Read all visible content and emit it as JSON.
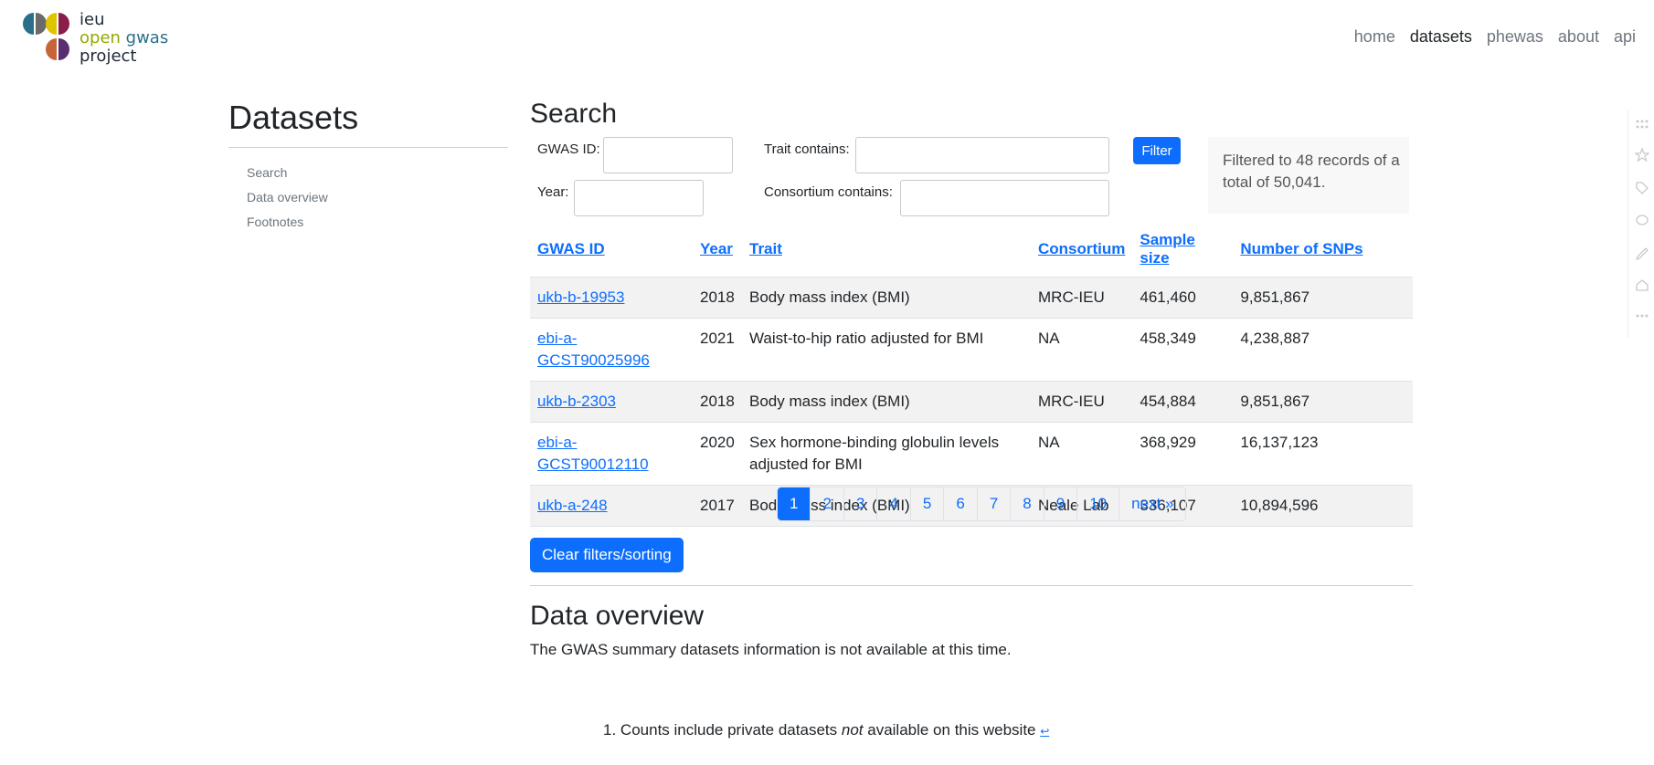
{
  "brand": {
    "line1": "ieu",
    "line2_a": "open",
    "line2_b": "gwas",
    "line3": "project"
  },
  "nav": [
    {
      "label": "home"
    },
    {
      "label": "datasets",
      "active": true
    },
    {
      "label": "phewas"
    },
    {
      "label": "about"
    },
    {
      "label": "api"
    }
  ],
  "sidebar": {
    "title": "Datasets",
    "items": [
      "Search",
      "Data overview",
      "Footnotes"
    ]
  },
  "search": {
    "title": "Search",
    "gwas_id_label": "GWAS ID:",
    "year_label": "Year:",
    "trait_label": "Trait contains:",
    "consortium_label": "Consortium contains:",
    "filter_button": "Filter",
    "records_text": "Filtered to 48 records of a total of 50,041."
  },
  "table": {
    "headers": [
      "GWAS ID",
      "Year",
      "Trait",
      "Consortium",
      "Sample size",
      "Number of SNPs"
    ],
    "rows": [
      [
        "ukb-b-19953",
        "2018",
        "Body mass index (BMI)",
        "MRC-IEU",
        "461,460",
        "9,851,867"
      ],
      [
        "ebi-a-GCST90025996",
        "2021",
        "Waist-to-hip ratio adjusted for BMI",
        "NA",
        "458,349",
        "4,238,887"
      ],
      [
        "ukb-b-2303",
        "2018",
        "Body mass index (BMI)",
        "MRC-IEU",
        "454,884",
        "9,851,867"
      ],
      [
        "ebi-a-GCST90012110",
        "2020",
        "Sex hormone-binding globulin levels adjusted for BMI",
        "NA",
        "368,929",
        "16,137,123"
      ],
      [
        "ukb-a-248",
        "2017",
        "Body mass index (BMI)",
        "Neale Lab",
        "336,107",
        "10,894,596"
      ]
    ]
  },
  "pagination": {
    "pages": [
      "1",
      "2",
      "3",
      "4",
      "5",
      "6",
      "7",
      "8",
      "9",
      "10"
    ],
    "next": "next »",
    "current": "1"
  },
  "clear_button": "Clear filters/sorting",
  "overview": {
    "title": "Data overview",
    "text": "The GWAS summary datasets information is not available at this time."
  },
  "footnote": {
    "number": "1.",
    "before": "Counts include private datasets",
    "em": "not",
    "after": "available on this website",
    "return": "↩"
  },
  "colors": {
    "accent": "#0d6efd",
    "logo_teal": "#2a6f8a",
    "logo_yellow": "#e0c400",
    "logo_orange": "#c8643a",
    "logo_purple": "#5a2d6e"
  },
  "toolstrip_icons": [
    "grid-icon",
    "star-icon",
    "tag-icon",
    "comment-icon",
    "pen-icon",
    "home-icon",
    "more-icon"
  ]
}
